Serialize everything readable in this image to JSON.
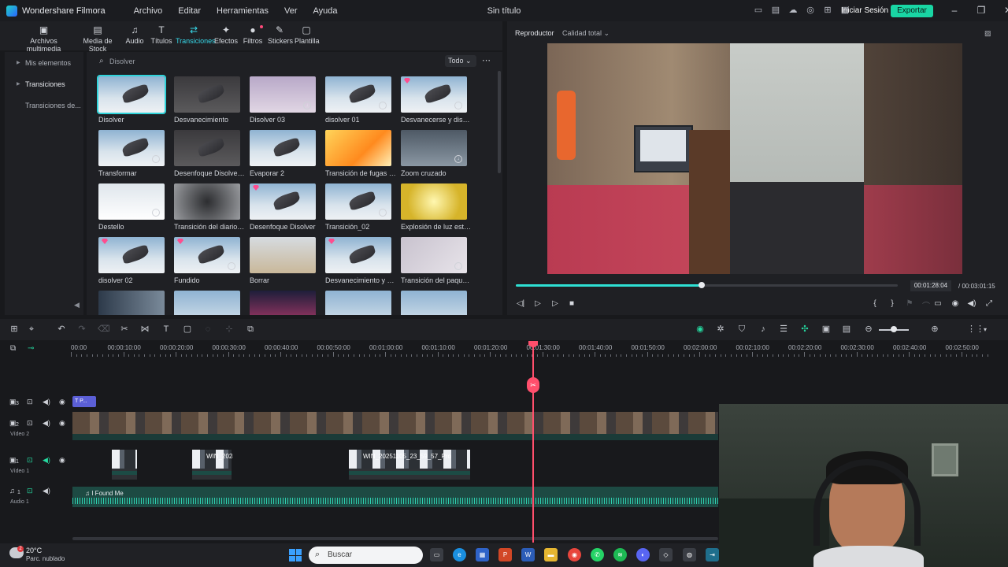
{
  "app": {
    "name": "Wondershare Filmora",
    "doc_title": "Sin título",
    "menu": [
      "Archivo",
      "Editar",
      "Herramientas",
      "Ver",
      "Ayuda"
    ],
    "sign_in": "Iniciar Sesión",
    "export": "Exportar",
    "accent": "#2fd3d9"
  },
  "media_tabs": [
    {
      "label": "Archivos multimedia",
      "icon": "media-folder-icon",
      "glyph": "▣"
    },
    {
      "label": "Media de Stock",
      "icon": "stock-media-icon",
      "glyph": "▤"
    },
    {
      "label": "Audio",
      "icon": "music-note-icon",
      "glyph": "♫"
    },
    {
      "label": "Títulos",
      "icon": "text-icon",
      "glyph": "T"
    },
    {
      "label": "Transiciones",
      "icon": "transitions-icon",
      "glyph": "⇄"
    },
    {
      "label": "Efectos",
      "icon": "effects-icon",
      "glyph": "✦"
    },
    {
      "label": "Filtros",
      "icon": "filters-icon",
      "glyph": "●"
    },
    {
      "label": "Stickers",
      "icon": "stickers-icon",
      "glyph": "✎"
    },
    {
      "label": "Plantilla",
      "icon": "template-icon",
      "glyph": "▢"
    }
  ],
  "sidebar": {
    "items": [
      {
        "label": "Mis elementos"
      },
      {
        "label": "Transiciones"
      },
      {
        "label": "Transiciones de..."
      }
    ]
  },
  "search": {
    "value": "Disolver",
    "filter": "Todo"
  },
  "transitions": [
    {
      "label": "Disolver",
      "style": "a"
    },
    {
      "label": "Desvanecimiento",
      "style": "b"
    },
    {
      "label": "Disolver 03",
      "style": "c"
    },
    {
      "label": "disolver 01",
      "style": "a"
    },
    {
      "label": "Desvanecerse y disolv...",
      "style": "a"
    },
    {
      "label": "Transformar",
      "style": "a"
    },
    {
      "label": "Desenfoque Disolver 1",
      "style": "b"
    },
    {
      "label": "Evaporar 2",
      "style": "a"
    },
    {
      "label": "Transición de fugas de...",
      "style": "e"
    },
    {
      "label": "Zoom cruzado",
      "style": "f"
    },
    {
      "label": "Destello",
      "style": "g"
    },
    {
      "label": "Transición del diario d...",
      "style": "h"
    },
    {
      "label": "Desenfoque Disolver",
      "style": "a"
    },
    {
      "label": "Transición_02",
      "style": "a"
    },
    {
      "label": "Explosión de luz estelar",
      "style": "i"
    },
    {
      "label": "disolver 02",
      "style": "a"
    },
    {
      "label": "Fundido",
      "style": "a"
    },
    {
      "label": "Borrar",
      "style": "j"
    },
    {
      "label": "Desvanecimiento y dis...",
      "style": "a"
    },
    {
      "label": "Transición del paquet...",
      "style": "k"
    }
  ],
  "player": {
    "tab": "Reproductor",
    "quality": "Calidad total",
    "current_time": "00:01:28:04",
    "total_time": "00:03:01:15",
    "progress": 0.487
  },
  "ruler": [
    "00:00",
    "00:00:10:00",
    "00:00:20:00",
    "00:00:30:00",
    "00:00:40:00",
    "00:00:50:00",
    "00:01:00:00",
    "00:01:10:00",
    "00:01:20:00",
    "00:01:30:00",
    "00:01:40:00",
    "00:01:50:00",
    "00:02:00:00",
    "00:02:10:00",
    "00:02:20:00",
    "00:02:30:00",
    "00:02:40:00",
    "00:02:50:00"
  ],
  "tracks": {
    "t3": "3",
    "t2": "2",
    "t2_name": "Vídeo 2",
    "t1": "1",
    "t1_name": "Vídeo 1",
    "a1": "1",
    "a1_name": "Audio 1",
    "title_clip": "P...",
    "clip_a": "WIN_2024",
    "clip_b": "WIN_20251105_23_59_57_Pro",
    "audio_clip": "I Found Me"
  },
  "taskbar": {
    "temp": "20°C",
    "condition": "Parc. nublado",
    "badge": "2",
    "search": "Buscar"
  }
}
